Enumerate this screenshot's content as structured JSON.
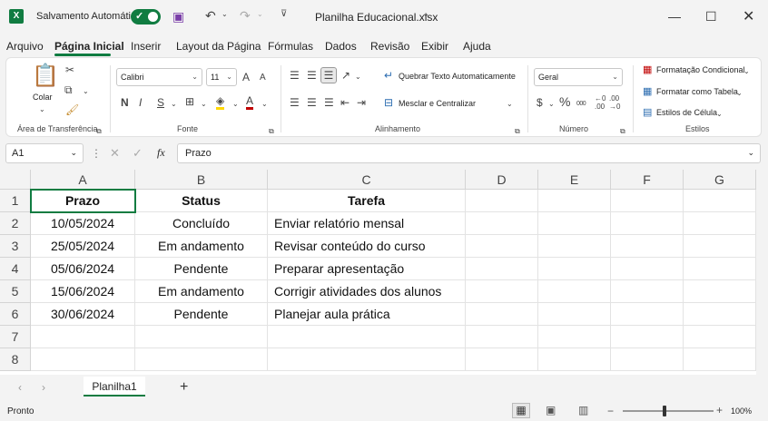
{
  "titlebar": {
    "app_logo": "X",
    "autosave_label": "Salvamento Automático",
    "autosave_on": true,
    "filename": "Planilha Educacional.xlsx",
    "icons": [
      "save-icon",
      "undo-icon",
      "redo-icon",
      "customize-icon"
    ]
  },
  "menu": {
    "items": [
      "Arquivo",
      "Página Inicial",
      "Inserir",
      "Layout da Página",
      "Fórmulas",
      "Dados",
      "Revisão",
      "Exibir",
      "Ajuda"
    ],
    "active": "Página Inicial"
  },
  "ribbon": {
    "clipboard": {
      "paste_label": "Colar",
      "group_label": "Área de Transferência"
    },
    "font": {
      "font_name": "Calibri",
      "font_size": "11",
      "grow": "A",
      "shrink": "A",
      "bold": "N",
      "italic": "I",
      "underline": "S",
      "group_label": "Fonte"
    },
    "alignment": {
      "wrap_label": "Quebrar Texto Automaticamente",
      "merge_label": "Mesclar e Centralizar",
      "group_label": "Alinhamento"
    },
    "number": {
      "format": "Geral",
      "currency": "$",
      "percent": "%",
      "comma": "000",
      "group_label": "Número"
    },
    "styles": {
      "conditional": "Formatação Condicional",
      "table": "Formatar como Tabela",
      "cell_styles": "Estilos de Célula",
      "group_label": "Estilos"
    }
  },
  "formula_bar": {
    "name_box": "A1",
    "fx": "fx",
    "content": "Prazo"
  },
  "grid": {
    "columns": [
      "A",
      "B",
      "C",
      "D",
      "E",
      "F",
      "G"
    ],
    "rows": [
      "1",
      "2",
      "3",
      "4",
      "5",
      "6",
      "7",
      "8"
    ],
    "header": {
      "prazo": "Prazo",
      "status": "Status",
      "tarefa": "Tarefa"
    },
    "data": [
      {
        "prazo": "10/05/2024",
        "status": "Concluído",
        "tarefa": "Enviar relatório mensal"
      },
      {
        "prazo": "25/05/2024",
        "status": "Em andamento",
        "tarefa": "Revisar conteúdo do curso"
      },
      {
        "prazo": "05/06/2024",
        "status": "Pendente",
        "tarefa": "Preparar apresentação"
      },
      {
        "prazo": "15/06/2024",
        "status": "Em andamento",
        "tarefa": "Corrigir atividades dos alunos"
      },
      {
        "prazo": "30/06/2024",
        "status": "Pendente",
        "tarefa": "Planejar aula prática"
      }
    ]
  },
  "sheets": {
    "tabs": [
      "Planilha1"
    ],
    "add": "+"
  },
  "status": {
    "text": "Pronto",
    "zoom": "100%",
    "zoom_level": 1.0
  },
  "colors": {
    "accent": "#107c41",
    "font_color": "#c00000",
    "highlight": "#ffd700"
  }
}
